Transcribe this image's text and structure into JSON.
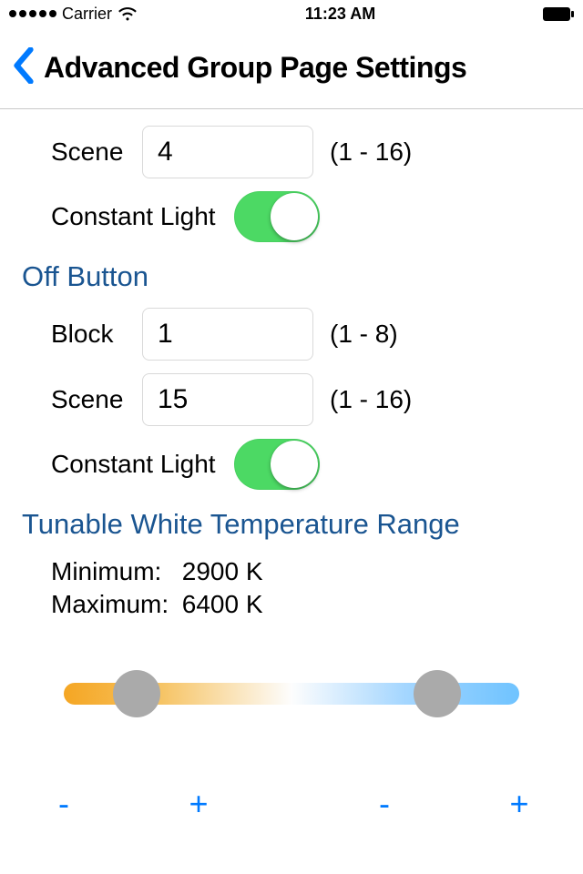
{
  "status_bar": {
    "carrier": "Carrier",
    "time": "11:23 AM"
  },
  "nav": {
    "title": "Advanced Group Page Settings"
  },
  "top_scene": {
    "label": "Scene",
    "value": "4",
    "range": "(1 - 16)"
  },
  "top_constant_light": {
    "label": "Constant Light",
    "on": true
  },
  "off_button_section": {
    "header": "Off Button",
    "block": {
      "label": "Block",
      "value": "1",
      "range": "(1 - 8)"
    },
    "scene": {
      "label": "Scene",
      "value": "15",
      "range": "(1 - 16)"
    },
    "constant_light": {
      "label": "Constant Light",
      "on": true
    }
  },
  "tunable_white": {
    "header": "Tunable White Temperature Range",
    "minimum_label": "Minimum:",
    "minimum_value": "2900 K",
    "maximum_label": "Maximum:",
    "maximum_value": "6400 K",
    "slider": {
      "low_pct": 16,
      "high_pct": 82
    },
    "fine_buttons": {
      "minus": "-",
      "plus": "+"
    }
  }
}
